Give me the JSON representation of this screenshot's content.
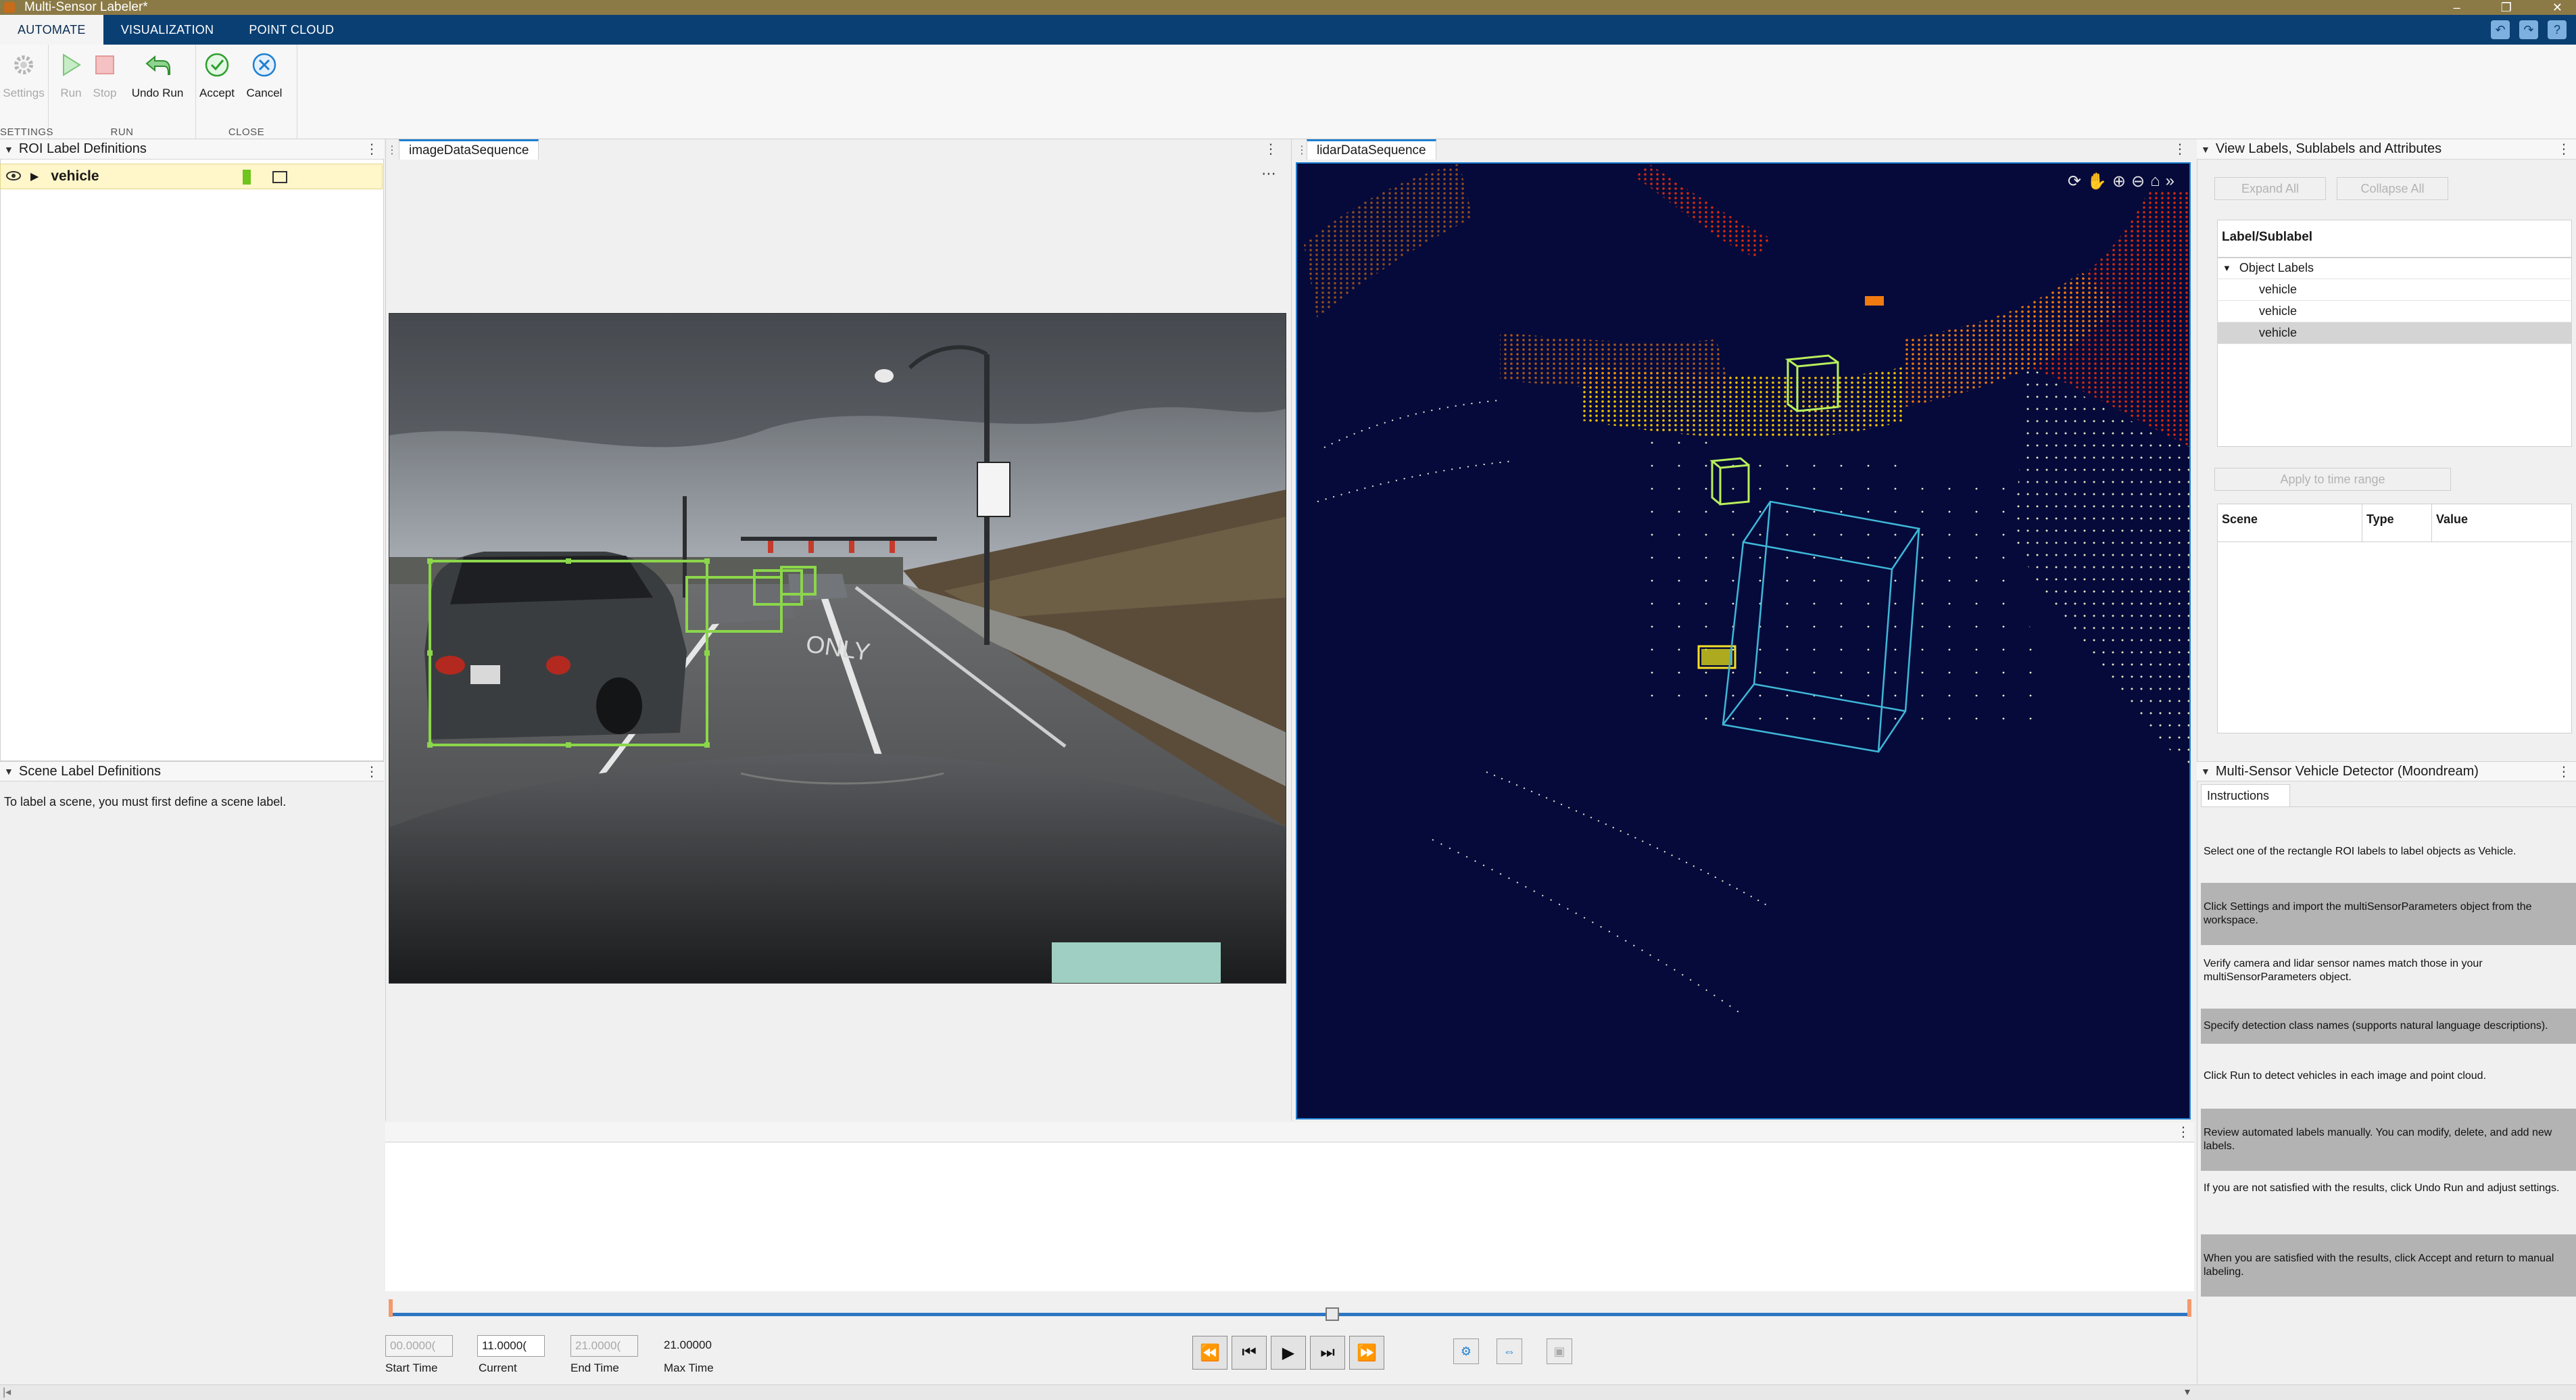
{
  "window": {
    "title": "Multi-Sensor Labeler*"
  },
  "tabs": [
    {
      "label": "AUTOMATE",
      "active": true
    },
    {
      "label": "VISUALIZATION",
      "active": false
    },
    {
      "label": "POINT CLOUD",
      "active": false
    }
  ],
  "toolstrip": {
    "settings_group": {
      "label": "SETTINGS",
      "settings": "Settings"
    },
    "run_group": {
      "label": "RUN",
      "run": "Run",
      "stop": "Stop",
      "undo_run": "Undo Run"
    },
    "close_group": {
      "label": "CLOSE",
      "accept": "Accept",
      "cancel": "Cancel"
    }
  },
  "roi_panel": {
    "title": "ROI Label Definitions",
    "labels": [
      {
        "name": "vehicle",
        "color": "#6fc41d"
      }
    ]
  },
  "scene_panel": {
    "title": "Scene Label Definitions",
    "message": "To label a scene, you must first define a scene label."
  },
  "documents": {
    "image_tab": "imageDataSequence",
    "lidar_tab": "lidarDataSequence"
  },
  "right_panel": {
    "title": "View Labels, Sublabels and Attributes",
    "expand_all": "Expand All",
    "collapse_all": "Collapse All",
    "tree_header": "Label/Sublabel",
    "tree_group": "Object Labels",
    "tree_items": [
      "vehicle",
      "vehicle",
      "vehicle"
    ],
    "apply_to_time_range": "Apply to time range",
    "table_headers": [
      "Scene",
      "Type",
      "Value"
    ]
  },
  "detector_panel": {
    "title": "Multi-Sensor Vehicle Detector (Moondream)",
    "tab": "Instructions",
    "instructions": [
      "Select one of the rectangle ROI labels to label objects as Vehicle.",
      "Click Settings and import the multiSensorParameters object from the workspace.",
      "Verify camera and lidar sensor names match those in your multiSensorParameters object.",
      "Specify detection class names (supports natural language descriptions).",
      "Click Run to detect vehicles in each image and point cloud.",
      "Review automated labels manually. You can modify, delete, and add new labels.",
      "If you are not satisfied with the results, click Undo Run and adjust settings.",
      "When you are satisfied with the results, click Accept and return to manual labeling."
    ]
  },
  "playback": {
    "start_time": "00.0000(",
    "current": "11.0000(",
    "end_time": "21.0000(",
    "max_time": "21.00000",
    "start_label": "Start Time",
    "current_label": "Current",
    "end_label": "End Time",
    "max_label": "Max Time",
    "position_fraction": 0.5238
  },
  "colors": {
    "accent": "#1e7fd0",
    "tab_bar": "#0a3f73",
    "title_bar": "#8b7a46",
    "box": "#6fc41d"
  }
}
